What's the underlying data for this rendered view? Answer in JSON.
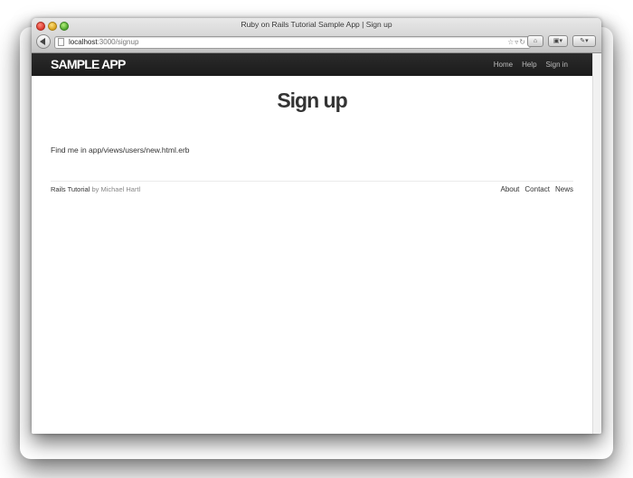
{
  "window": {
    "title": "Ruby on Rails Tutorial Sample App | Sign up"
  },
  "address_bar": {
    "host": "localhost",
    "path": ":3000/signup"
  },
  "navbar": {
    "logo": "SAMPLE APP",
    "links": [
      "Home",
      "Help",
      "Sign in"
    ]
  },
  "page": {
    "heading": "Sign up",
    "body_text": "Find me in app/views/users/new.html.erb"
  },
  "footer": {
    "brand": "Rails Tutorial",
    "author": "by Michael Hartl",
    "links": [
      "About",
      "Contact",
      "News"
    ]
  },
  "colors": {
    "navbar_bg": "#222222",
    "nav_link": "#bdbdbd",
    "text": "#333333"
  }
}
